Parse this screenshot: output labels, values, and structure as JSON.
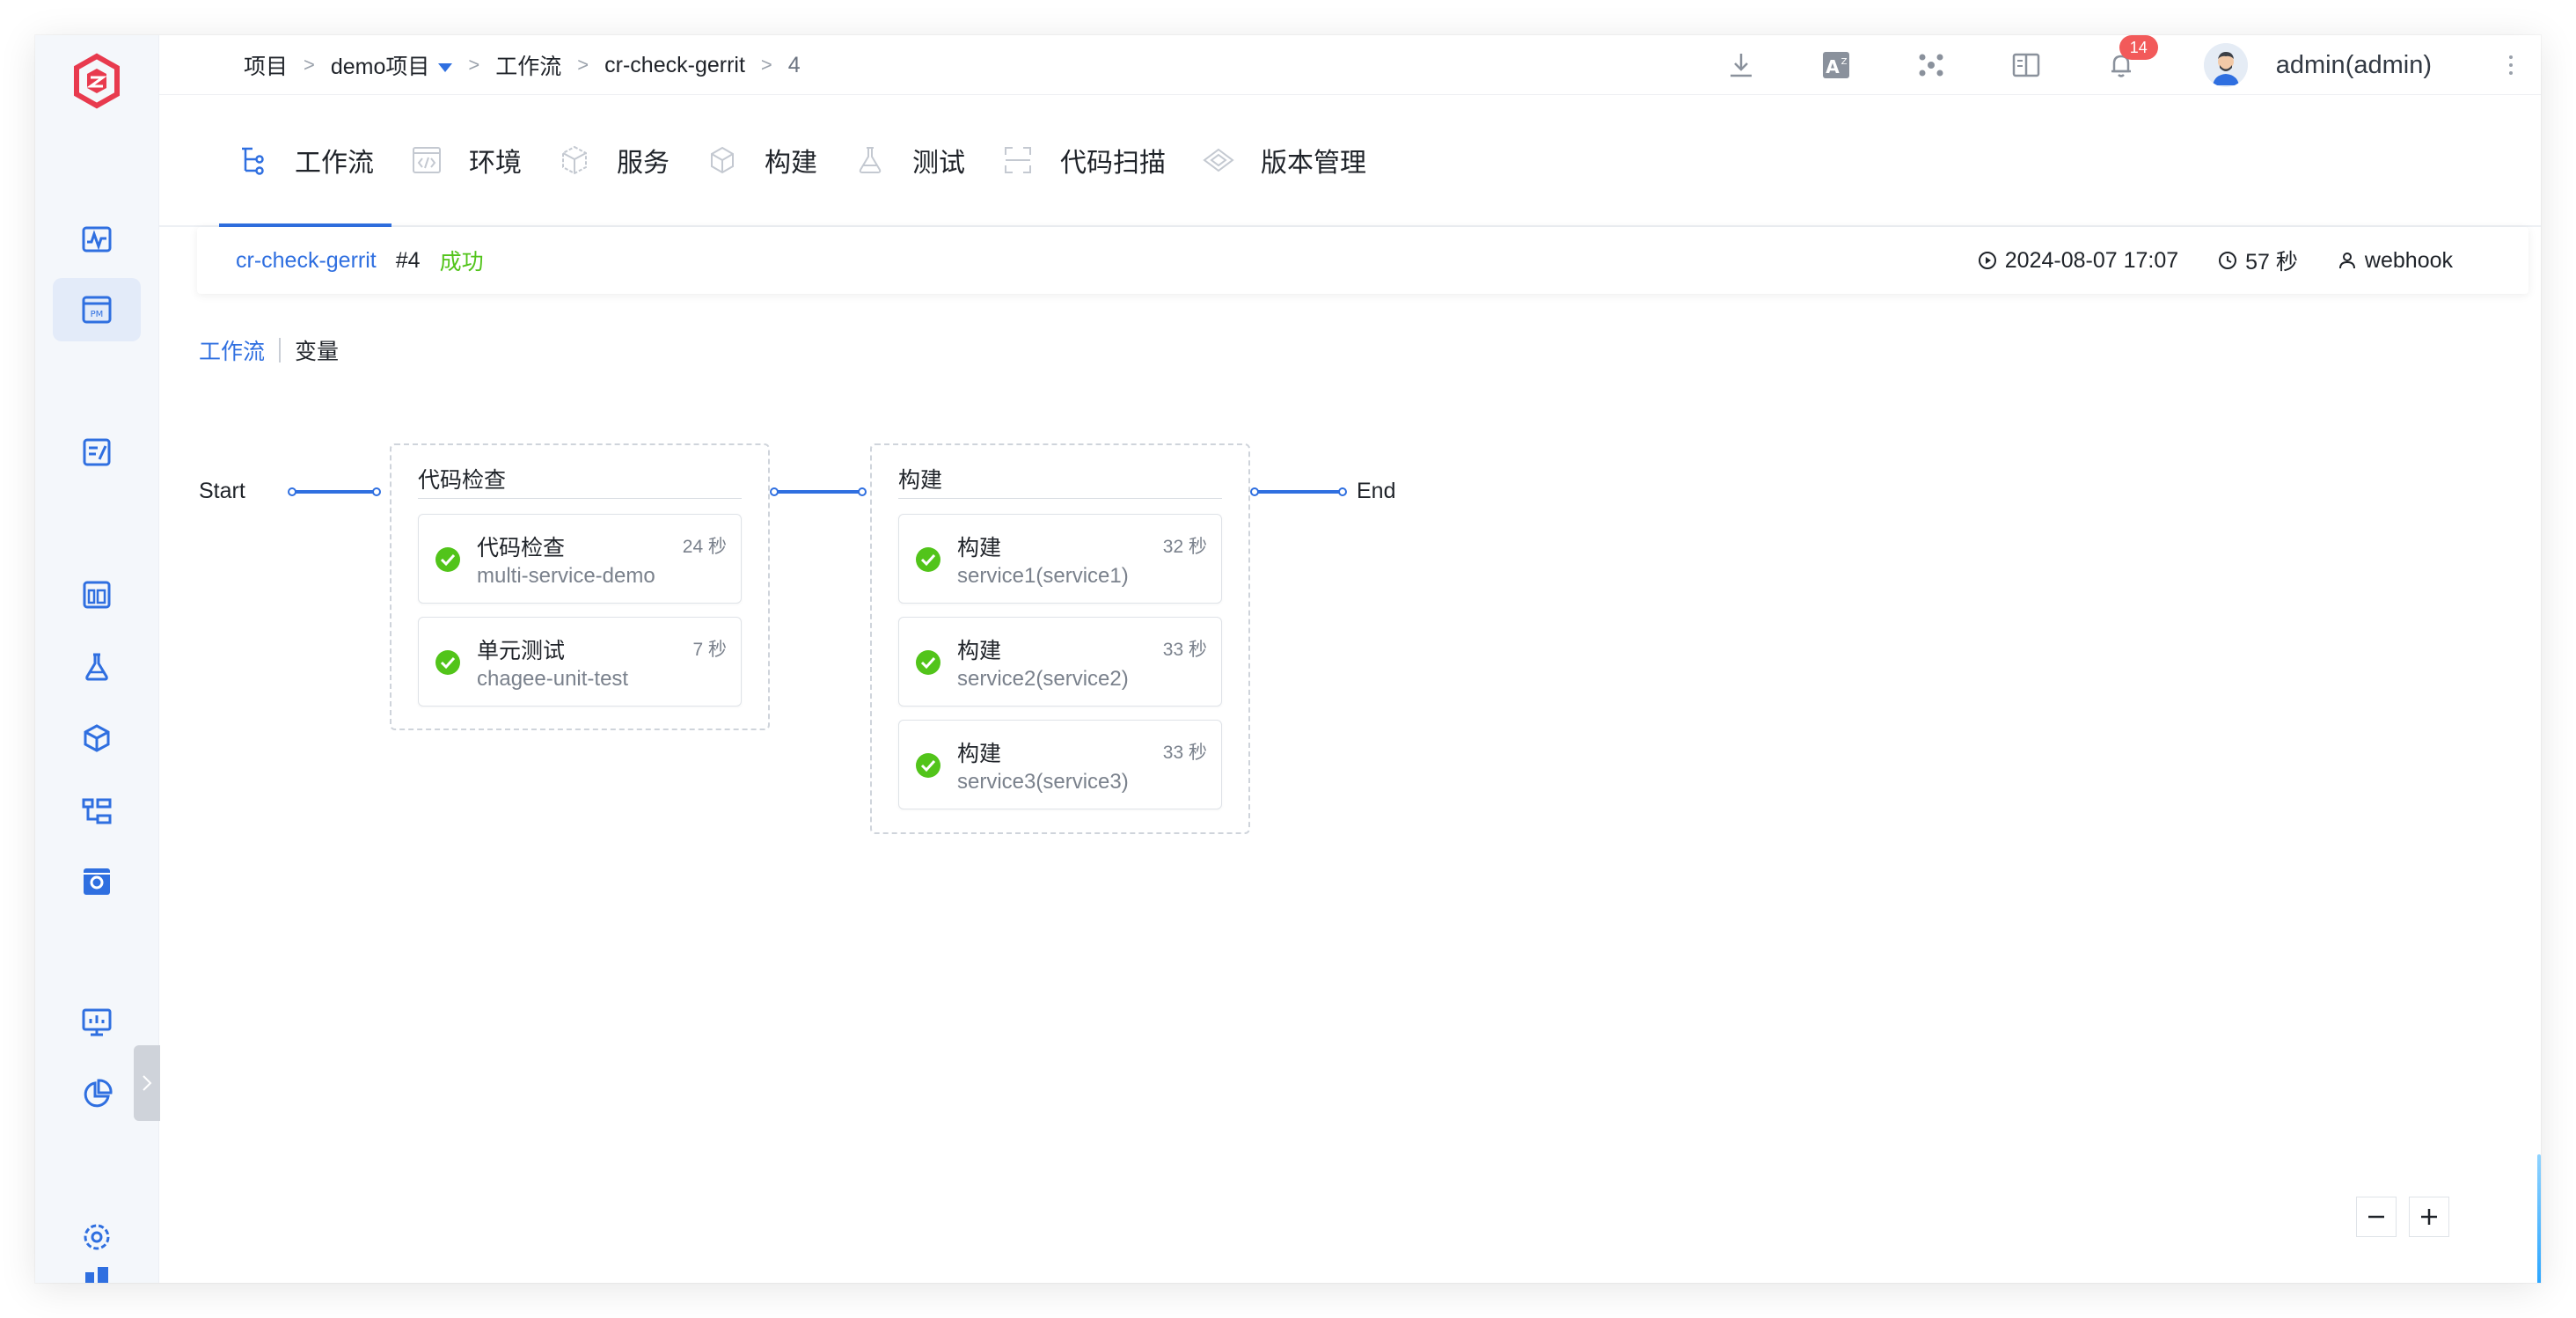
{
  "breadcrumb": {
    "project": "项目",
    "project_name": "demo项目",
    "workflows": "工作流",
    "workflow": "cr-check-gerrit",
    "run": "4",
    "separator": ">"
  },
  "header": {
    "notification_count": "14",
    "user": "admin(admin)",
    "icons": [
      "download-icon",
      "translate-icon",
      "plugin-icon",
      "docs-icon",
      "bell-icon"
    ]
  },
  "tabs": [
    {
      "label": "工作流",
      "icon": "workflow-icon",
      "active": true
    },
    {
      "label": "环境",
      "icon": "environment-icon"
    },
    {
      "label": "服务",
      "icon": "service-icon"
    },
    {
      "label": "构建",
      "icon": "build-icon"
    },
    {
      "label": "测试",
      "icon": "test-icon"
    },
    {
      "label": "代码扫描",
      "icon": "scan-icon"
    },
    {
      "label": "版本管理",
      "icon": "version-icon"
    }
  ],
  "summary": {
    "workflow": "cr-check-gerrit",
    "run": "#4",
    "status": "成功",
    "start_time": "2024-08-07 17:07",
    "duration": "57 秒",
    "trigger": "webhook"
  },
  "subtabs": {
    "workflow": "工作流",
    "variables": "变量"
  },
  "pipeline": {
    "start": "Start",
    "end": "End",
    "stages": [
      {
        "title": "代码检查",
        "jobs": [
          {
            "name": "代码检查",
            "sub": "multi-service-demo",
            "duration": "24 秒"
          },
          {
            "name": "单元测试",
            "sub": "chagee-unit-test",
            "duration": "7 秒"
          }
        ]
      },
      {
        "title": "构建",
        "jobs": [
          {
            "name": "构建",
            "sub": "service1(service1)",
            "duration": "32 秒"
          },
          {
            "name": "构建",
            "sub": "service2(service2)",
            "duration": "33 秒"
          },
          {
            "name": "构建",
            "sub": "service3(service3)",
            "duration": "33 秒"
          }
        ]
      }
    ]
  },
  "colors": {
    "accent": "#2f6fe0",
    "success": "#52c41a",
    "badge": "#f25a5a"
  }
}
